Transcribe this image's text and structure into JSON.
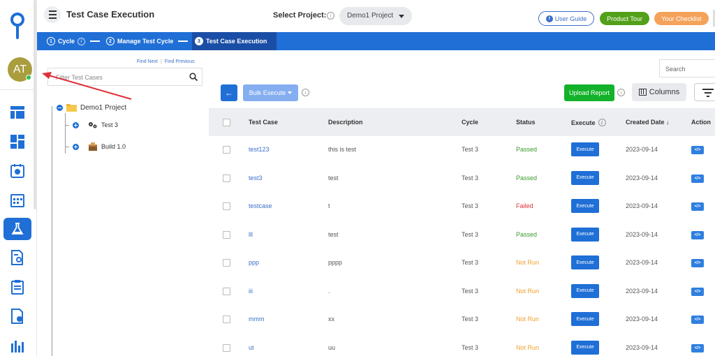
{
  "user": {
    "initials": "AT"
  },
  "header": {
    "title": "Test Case Execution",
    "select_project_label": "Select Project:",
    "project": "Demo1 Project",
    "user_guide": "User Guide",
    "product_tour": "Product Tour",
    "checklist": "Your Checklist"
  },
  "breadcrumb": [
    {
      "num": "1",
      "label": "Cycle"
    },
    {
      "num": "2",
      "label": "Manage Test Cycle"
    },
    {
      "num": "3",
      "label": "Test Case Execution"
    }
  ],
  "tree": {
    "find_next": "Find Next",
    "find_previous": "Find Previous",
    "filter_placeholder": "Filter Test Cases",
    "root": "Demo1 Project",
    "children": [
      "Test 3",
      "Build 1.0"
    ]
  },
  "toolbar": {
    "search_placeholder": "Search",
    "bulk_execute": "Bulk Execute",
    "upload_report": "Upload Report",
    "columns": "Columns"
  },
  "table": {
    "headers": {
      "test_case": "Test Case",
      "description": "Description",
      "cycle": "Cycle",
      "status": "Status",
      "execute": "Execute",
      "created_date": "Created Date ↓",
      "action": "Action"
    },
    "execute_label": "Execute",
    "action_label": "</>",
    "rows": [
      {
        "test_case": "test123",
        "description": "this is test",
        "cycle": "Test 3",
        "status": "Passed",
        "date": "2023-09-14"
      },
      {
        "test_case": "test3",
        "description": "test",
        "cycle": "Test 3",
        "status": "Passed",
        "date": "2023-09-14"
      },
      {
        "test_case": "testcase",
        "description": "t",
        "cycle": "Test 3",
        "status": "Failed",
        "date": "2023-09-14"
      },
      {
        "test_case": "lll",
        "description": "test",
        "cycle": "Test 3",
        "status": "Passed",
        "date": "2023-09-14"
      },
      {
        "test_case": "ppp",
        "description": "pppp",
        "cycle": "Test 3",
        "status": "Not Run",
        "date": "2023-09-14"
      },
      {
        "test_case": "iii",
        "description": ".",
        "cycle": "Test 3",
        "status": "Not Run",
        "date": "2023-09-14"
      },
      {
        "test_case": "mmm",
        "description": "xx",
        "cycle": "Test 3",
        "status": "Not Run",
        "date": "2023-09-14"
      },
      {
        "test_case": "ut",
        "description": "uu",
        "cycle": "Test 3",
        "status": "Not Run",
        "date": "2023-09-14"
      }
    ]
  },
  "nav_icons": [
    "dashboard-icon",
    "widgets-icon",
    "settings-report-icon",
    "calendar-report-icon",
    "flask-icon",
    "document-search-icon",
    "clipboard-icon",
    "document-settings-icon",
    "bar-chart-icon"
  ],
  "colors": {
    "primary": "#1f6fd6",
    "passed": "#3a9a2e",
    "failed": "#e0303a",
    "not_run": "#f0a030",
    "annotation_arrow": "#e0303a"
  }
}
